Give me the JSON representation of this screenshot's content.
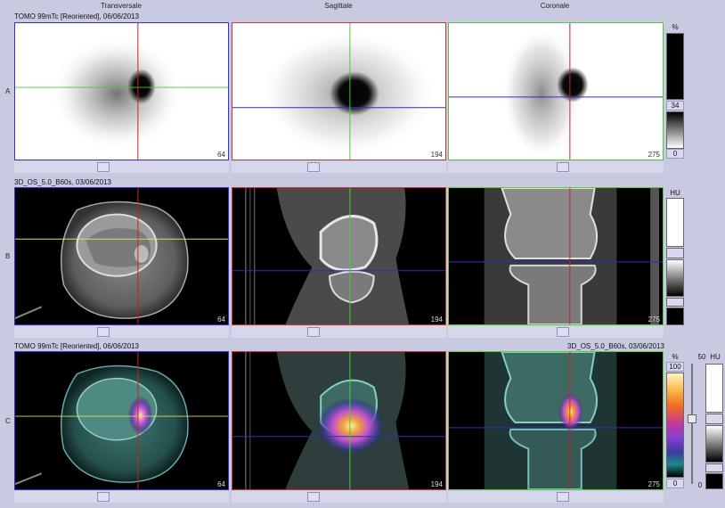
{
  "columns": {
    "transversal": "Transversale",
    "sagittal": "Sagittale",
    "coronal": "Coronale"
  },
  "rows": [
    {
      "label": "A",
      "caption": "TOMO 99mTc [Reoriented], 06/06/2013"
    },
    {
      "label": "B",
      "caption": "3D_OS_5.0_B60s, 03/06/2013"
    },
    {
      "label": "C",
      "caption": "TOMO 99mTc [Reoriented], 06/06/2013",
      "caption_right": "3D_OS_5.0_B60s, 03/06/2013"
    }
  ],
  "slices": {
    "transversal": "64",
    "sagittal": "194",
    "coronal": "275"
  },
  "scales": {
    "row_a": {
      "unit": "%",
      "max": "34",
      "min": "0"
    },
    "row_b": {
      "unit": "HU"
    },
    "row_c": {
      "unit_pct": "%",
      "max": "100",
      "min": "0",
      "unit_hu": "HU",
      "hu_value": "50",
      "hu_min": "0"
    }
  },
  "colors": {
    "transversal_border": "#3333cc",
    "sagittal_border": "#cc3333",
    "coronal_border": "#55cc33",
    "crosshair_red": "#cc2222",
    "crosshair_green": "#44cc33",
    "crosshair_blue": "#2233bb",
    "crosshair_yellow": "#dddd66",
    "background": "#c9c9e2"
  }
}
